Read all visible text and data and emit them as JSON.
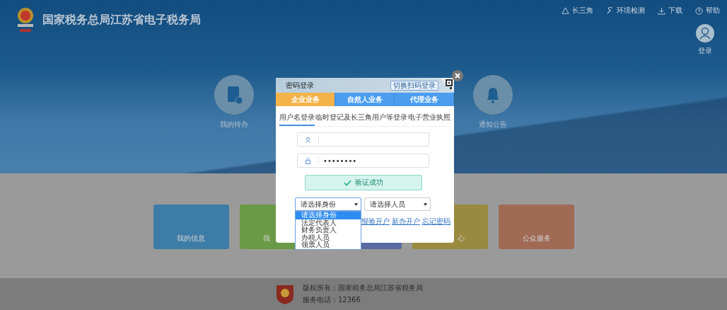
{
  "header": {
    "title": "国家税务总局江苏省电子税务局",
    "nav": [
      {
        "label": "长三角"
      },
      {
        "label": "环境检测"
      },
      {
        "label": "下载"
      },
      {
        "label": "帮助"
      }
    ],
    "login": "登录"
  },
  "shortcuts": [
    {
      "label": "我的待办"
    },
    {
      "label": "通知公告"
    }
  ],
  "tiles": [
    {
      "label": "我的信息",
      "color": "#3d7ca6"
    },
    {
      "label": "我",
      "color": "#6a9a45"
    },
    {
      "color": "#5a6aa0"
    },
    {
      "label": "心",
      "color": "#9a8a3f"
    },
    {
      "label": "公众服务",
      "color": "#a06a55"
    }
  ],
  "modal": {
    "title": "密码登录",
    "switch_label": "切换扫码登录",
    "business_tabs": [
      {
        "label": "企业业务",
        "selected": true
      },
      {
        "label": "自然人业务",
        "selected": false
      },
      {
        "label": "代理业务",
        "selected": false
      }
    ],
    "login_tabs": [
      {
        "label": "用户名登录",
        "selected": true
      },
      {
        "label": "临时登记及长三角用户等登录",
        "selected": false
      },
      {
        "label": "电子营业执照",
        "selected": false
      }
    ],
    "password": "••••••••",
    "verify": {
      "label": "验证成功",
      "verified": true
    },
    "selects": [
      {
        "value": "请选择身份",
        "open": true,
        "options": [
          {
            "label": "请选择身份",
            "selected": true
          },
          {
            "label": "法定代表人",
            "selected": false
          },
          {
            "label": "财务负责人",
            "selected": false
          },
          {
            "label": "办税人员",
            "selected": false
          },
          {
            "label": "领票人员",
            "selected": false
          }
        ]
      },
      {
        "value": "请选择人员",
        "open": false
      }
    ],
    "links": [
      "报验开户",
      "新办开户",
      "忘记密码"
    ]
  },
  "footer": {
    "copyright": "版权所有：国家税务总局江苏省税务局",
    "phone": "服务电话：12366"
  }
}
